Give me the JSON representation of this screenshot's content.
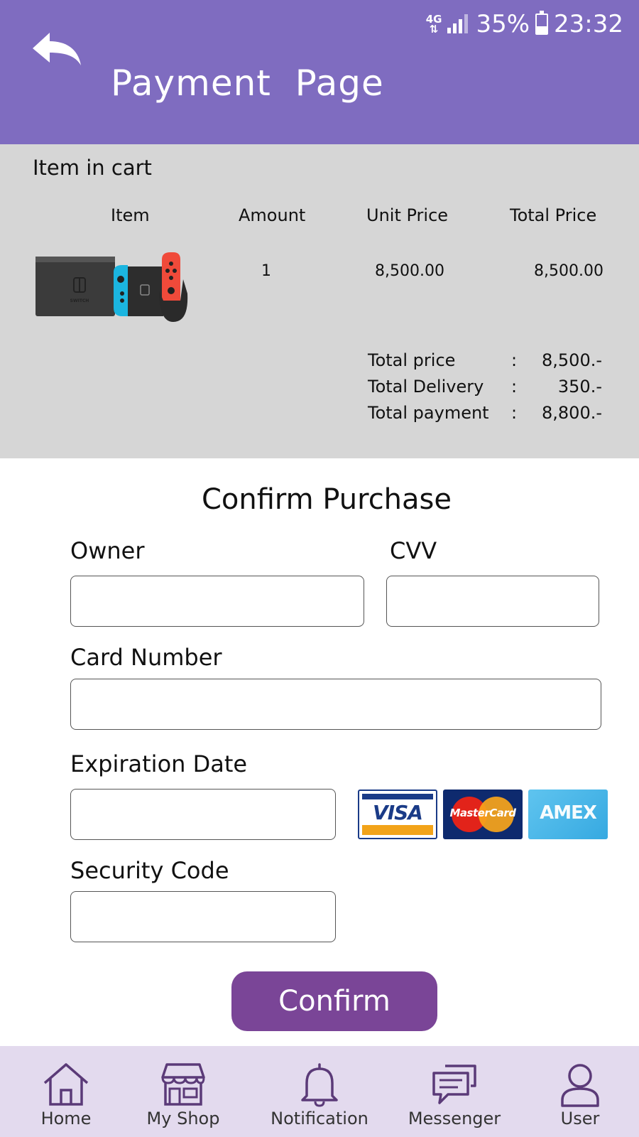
{
  "status_bar": {
    "network": "4G",
    "battery": "35%",
    "time": "23:32"
  },
  "header": {
    "title": "Payment  Page"
  },
  "cart": {
    "heading": "Item in cart",
    "columns": [
      "Item",
      "Amount",
      "Unit Price",
      "Total Price"
    ],
    "items": [
      {
        "image": "Nintendo Switch console",
        "amount": "1",
        "unit_price": "8,500.00",
        "total_price": "8,500.00"
      }
    ],
    "summary": [
      {
        "label": "Total price",
        "colon": ":",
        "value": "8,500.-"
      },
      {
        "label": "Total Delivery",
        "colon": ":",
        "value": "350.-"
      },
      {
        "label": "Total payment",
        "colon": ":",
        "value": "8,800.-"
      }
    ]
  },
  "form": {
    "title": "Confirm Purchase",
    "owner_label": "Owner",
    "owner_value": "",
    "cvv_label": "CVV",
    "cvv_value": "",
    "card_number_label": "Card Number",
    "card_number_value": "",
    "expiration_label": "Expiration Date",
    "expiration_value": "",
    "security_label": "Security Code",
    "security_value": "",
    "card_logos": [
      "VISA",
      "MasterCard",
      "AMEX"
    ],
    "confirm_label": "Confirm"
  },
  "nav": {
    "items": [
      {
        "label": "Home",
        "icon": "home-icon"
      },
      {
        "label": "My Shop",
        "icon": "shop-icon"
      },
      {
        "label": "Notification",
        "icon": "bell-icon"
      },
      {
        "label": "Messenger",
        "icon": "chat-icon"
      },
      {
        "label": "User",
        "icon": "user-icon"
      }
    ]
  },
  "colors": {
    "header": "#7f6cc0",
    "cart_bg": "#d6d6d6",
    "confirm_button": "#7a4597",
    "nav_bg": "#e3daee",
    "nav_icon": "#5b3a78"
  }
}
